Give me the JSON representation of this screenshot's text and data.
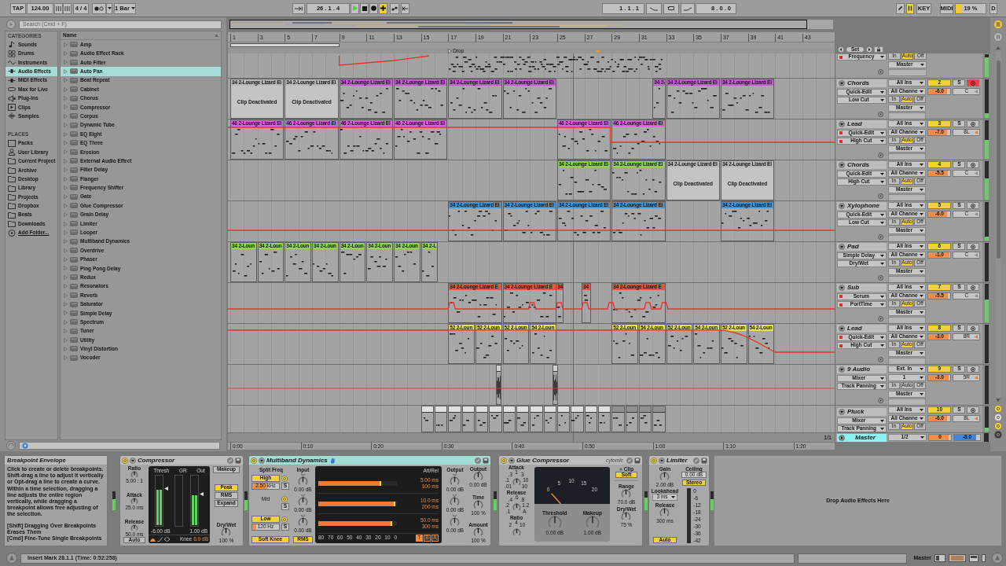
{
  "transport": {
    "tap": "TAP",
    "tempo": "124.00",
    "signature": "4 / 4",
    "quantize": "1 Bar",
    "position": "26 . 1 . 4",
    "playing": true,
    "recording": false,
    "overdub": true,
    "loop_start": "1 . 1 . 1",
    "loop_length": "8 . 0 . 0",
    "draw_mode": false,
    "computer_keyboard": true,
    "key": "KEY",
    "midi": "MIDI",
    "cpu": {
      "reading": "19 %",
      "level": 0.19
    },
    "disk": "D"
  },
  "browser": {
    "search": {
      "placeholder": "Search (Cmd + F)"
    },
    "categories_title": "CATEGORIES",
    "categories": [
      {
        "label": "Sounds",
        "kind": "sounds",
        "selected": false
      },
      {
        "label": "Drums",
        "kind": "drums",
        "selected": false
      },
      {
        "label": "Instruments",
        "kind": "instruments",
        "selected": false
      },
      {
        "label": "Audio Effects",
        "kind": "audio",
        "selected": true
      },
      {
        "label": "MIDI Effects",
        "kind": "midi",
        "selected": false
      },
      {
        "label": "Max for Live",
        "kind": "max",
        "selected": false
      },
      {
        "label": "Plug-ins",
        "kind": "plugins",
        "selected": false
      },
      {
        "label": "Clips",
        "kind": "clips",
        "selected": false
      },
      {
        "label": "Samples",
        "kind": "samples",
        "selected": false
      }
    ],
    "places_title": "PLACES",
    "places": [
      {
        "label": "Packs",
        "kind": "packs"
      },
      {
        "label": "User Library",
        "kind": "user"
      },
      {
        "label": "Current Project",
        "kind": "project"
      },
      {
        "label": "Archive",
        "kind": "folder"
      },
      {
        "label": "Desktop",
        "kind": "folder"
      },
      {
        "label": "Library",
        "kind": "folder"
      },
      {
        "label": "Projects",
        "kind": "folder"
      },
      {
        "label": "Dropbox",
        "kind": "folder"
      },
      {
        "label": "Beats",
        "kind": "folder"
      },
      {
        "label": "Downloads",
        "kind": "folder"
      },
      {
        "label": "Add Folder...",
        "kind": "add"
      }
    ],
    "column": "Name",
    "items": [
      {
        "label": "Amp",
        "selected": false
      },
      {
        "label": "Audio Effect Rack",
        "selected": false
      },
      {
        "label": "Auto Filter",
        "selected": false
      },
      {
        "label": "Auto Pan",
        "selected": true
      },
      {
        "label": "Beat Repeat",
        "selected": false
      },
      {
        "label": "Cabinet",
        "selected": false
      },
      {
        "label": "Chorus",
        "selected": false
      },
      {
        "label": "Compressor",
        "selected": false
      },
      {
        "label": "Corpus",
        "selected": false
      },
      {
        "label": "Dynamic Tube",
        "selected": false
      },
      {
        "label": "EQ Eight",
        "selected": false
      },
      {
        "label": "EQ Three",
        "selected": false
      },
      {
        "label": "Erosion",
        "selected": false
      },
      {
        "label": "External Audio Effect",
        "selected": false
      },
      {
        "label": "Filter Delay",
        "selected": false
      },
      {
        "label": "Flanger",
        "selected": false
      },
      {
        "label": "Frequency Shifter",
        "selected": false
      },
      {
        "label": "Gate",
        "selected": false
      },
      {
        "label": "Glue Compressor",
        "selected": false
      },
      {
        "label": "Grain Delay",
        "selected": false
      },
      {
        "label": "Limiter",
        "selected": false
      },
      {
        "label": "Looper",
        "selected": false
      },
      {
        "label": "Multiband Dynamics",
        "selected": false
      },
      {
        "label": "Overdrive",
        "selected": false
      },
      {
        "label": "Phaser",
        "selected": false
      },
      {
        "label": "Ping Pong Delay",
        "selected": false
      },
      {
        "label": "Redux",
        "selected": false
      },
      {
        "label": "Resonators",
        "selected": false
      },
      {
        "label": "Reverb",
        "selected": false
      },
      {
        "label": "Saturator",
        "selected": false
      },
      {
        "label": "Simple Delay",
        "selected": false
      },
      {
        "label": "Spectrum",
        "selected": false
      },
      {
        "label": "Tuner",
        "selected": false
      },
      {
        "label": "Utility",
        "selected": false
      },
      {
        "label": "Vinyl Distortion",
        "selected": false
      },
      {
        "label": "Vocoder",
        "selected": false
      }
    ]
  },
  "arrangement": {
    "bars": [
      "1",
      "3",
      "5",
      "7",
      "9",
      "11",
      "13",
      "15",
      "17",
      "19",
      "21",
      "23",
      "25",
      "27",
      "29",
      "31",
      "33",
      "35",
      "37",
      "39",
      "41",
      "43"
    ],
    "marker": "Drop",
    "set": "Set",
    "tracks": [
      {
        "parameter": {
          "label": "Frequency",
          "automated": true
        },
        "monitor": [
          {
            "label": "In",
            "selected": false
          },
          {
            "label": "Auto",
            "selected": true
          },
          {
            "label": "Off",
            "selected": false
          }
        ],
        "output": "Master",
        "meter": {
          "level": 0.85
        }
      },
      {
        "kind": "midi",
        "title": {
          "label": "Chords",
          "selected": false
        },
        "device": {
          "label": "Quick-Edit",
          "automated": false
        },
        "parameter": {
          "label": "Low Cut",
          "automated": false
        },
        "input": "All Ins",
        "channel": "All Channe",
        "monitor": [
          {
            "label": "In",
            "selected": false
          },
          {
            "label": "Auto",
            "selected": true
          },
          {
            "label": "Off",
            "selected": false
          }
        ],
        "output": "Master",
        "activator": {
          "label": "2",
          "on": true
        },
        "solo": "S",
        "armed": true,
        "volume": {
          "reading": "-6.0",
          "level": 0.86
        },
        "pan": {
          "reading": "C",
          "on": false
        },
        "meter": {
          "level": 0.12
        },
        "clips": [
          {
            "title": "34 2-Lounge Lizard El",
            "active": false,
            "note": "Clip Deactivated"
          },
          {
            "title": "34 2-Lounge Lizard El",
            "active": false,
            "note": "Clip Deactivated"
          },
          {
            "title": "34 2-Lounge Lizard El",
            "active": true,
            "color": "#c25ecf"
          },
          {
            "title": "34 2-Lounge Lizard El",
            "active": true,
            "color": "#c25ecf"
          },
          {
            "title": "34 2-Lounge Lizard El",
            "active": true,
            "color": "#c25ecf"
          },
          {
            "title": "34 2-Lounge Lizard El",
            "active": true,
            "color": "#c25ecf"
          },
          {
            "title": "34 2-",
            "active": true,
            "color": "#c25ecf"
          },
          {
            "title": "34 2-Lounge Lizard El",
            "active": true,
            "color": "#c25ecf"
          },
          {
            "title": "34 2-Lounge Lizard El",
            "active": true,
            "color": "#c25ecf"
          }
        ]
      },
      {
        "kind": "midi",
        "title": {
          "label": "Lead",
          "selected": false
        },
        "device": {
          "label": "Quick-Edit",
          "automated": true
        },
        "parameter": {
          "label": "High Cut",
          "automated": true
        },
        "input": "All Ins",
        "channel": "All Channe",
        "monitor": [
          {
            "label": "In",
            "selected": false
          },
          {
            "label": "Auto",
            "selected": true
          },
          {
            "label": "Off",
            "selected": false
          }
        ],
        "output": "Master",
        "activator": {
          "label": "3",
          "on": true
        },
        "solo": "S",
        "armed": false,
        "volume": {
          "reading": "-7.0",
          "level": 0.84
        },
        "pan": {
          "reading": "8L",
          "on": true
        },
        "meter": {
          "level": 0.5
        },
        "clips": [
          {
            "title": "46 2-Lounge Lizard El",
            "active": true,
            "color": "#e05ce2"
          },
          {
            "title": "46 2-Lounge Lizard El",
            "active": true,
            "color": "#e05ce2"
          },
          {
            "title": "46 2-Lounge Lizard El",
            "active": true,
            "color": "#e05ce2"
          },
          {
            "title": "46 2-Lounge Lizard El",
            "active": true,
            "color": "#e05ce2"
          },
          {
            "title": "46 2-Lounge Lizard El",
            "active": true,
            "color": "#e05ce2"
          },
          {
            "title": "46 2-Lounge Lizard El",
            "active": true,
            "color": "#e05ce2"
          }
        ]
      },
      {
        "kind": "midi",
        "title": {
          "label": "Chords",
          "selected": false
        },
        "device": {
          "label": "Quick-Edit",
          "automated": false
        },
        "parameter": {
          "label": "High Cut",
          "automated": false
        },
        "input": "All Ins",
        "channel": "All Channe",
        "monitor": [
          {
            "label": "In",
            "selected": false
          },
          {
            "label": "Auto",
            "selected": true
          },
          {
            "label": "Off",
            "selected": false
          }
        ],
        "output": "Master",
        "activator": {
          "label": "4",
          "on": true
        },
        "solo": "S",
        "armed": false,
        "volume": {
          "reading": "-5.5",
          "level": 0.87
        },
        "pan": {
          "reading": "C",
          "on": false
        },
        "meter": {
          "level": 0.55
        },
        "clips": [
          {
            "title": "34 2-Lounge Lizard El",
            "active": true,
            "color": "#8dd642"
          },
          {
            "title": "34 2-Lounge Lizard El",
            "active": true,
            "color": "#8dd642"
          },
          {
            "title": "34 2-Lounge Lizard El",
            "active": false,
            "note": "Clip Deactivated"
          },
          {
            "title": "34 2-Lounge Lizard El",
            "active": false,
            "note": "Clip Deactivated"
          }
        ]
      },
      {
        "kind": "midi",
        "title": {
          "label": "Xylophone",
          "selected": false
        },
        "device": {
          "label": "Quick-Edit",
          "automated": false
        },
        "parameter": {
          "label": "Low Cut",
          "automated": false
        },
        "input": "All Ins",
        "channel": "All Channe",
        "monitor": [
          {
            "label": "In",
            "selected": false
          },
          {
            "label": "Auto",
            "selected": true
          },
          {
            "label": "Off",
            "selected": false
          }
        ],
        "output": "Master",
        "activator": {
          "label": "5",
          "on": true
        },
        "solo": "S",
        "armed": false,
        "volume": {
          "reading": "-6.0",
          "level": 0.86
        },
        "pan": {
          "reading": "C",
          "on": false
        },
        "meter": {
          "level": 0.1
        },
        "clips": [
          {
            "title": "34 2-Lounge Lizard El",
            "active": true,
            "color": "#3f96d8"
          },
          {
            "title": "34 2-Lounge Lizard El",
            "active": true,
            "color": "#3f96d8"
          },
          {
            "title": "34 2-Lounge Lizard El",
            "active": true,
            "color": "#3f96d8"
          },
          {
            "title": "34 2-Lounge Lizard El",
            "active": true,
            "color": "#3f96d8"
          },
          {
            "title": "34 2-Lounge Lizard El",
            "active": true,
            "color": "#3f96d8"
          }
        ]
      },
      {
        "kind": "midi",
        "title": {
          "label": "Pad",
          "selected": false
        },
        "device": {
          "label": "Simple Delay",
          "automated": false
        },
        "parameter": {
          "label": "Dry/Wet",
          "automated": false
        },
        "input": "All Ins",
        "channel": "All Channe",
        "monitor": [
          {
            "label": "In",
            "selected": false
          },
          {
            "label": "Auto",
            "selected": true
          },
          {
            "label": "Off",
            "selected": false
          }
        ],
        "output": "Master",
        "activator": {
          "label": "6",
          "on": true
        },
        "solo": "S",
        "armed": false,
        "volume": {
          "reading": "-1.0",
          "level": 0.96
        },
        "pan": {
          "reading": "C",
          "on": false
        },
        "clips": [
          {
            "title": "34 2-Loun",
            "active": true,
            "color": "#92d64c"
          },
          {
            "title": "34 2-Loun",
            "active": true,
            "color": "#92d64c"
          },
          {
            "title": "34 2-Loun",
            "active": true,
            "color": "#92d64c"
          },
          {
            "title": "34 2-Loun",
            "active": true,
            "color": "#92d64c"
          },
          {
            "title": "34 2-Loun",
            "active": true,
            "color": "#92d64c"
          },
          {
            "title": "34 2-Loun",
            "active": true,
            "color": "#92d64c"
          },
          {
            "title": "34 2-Loun",
            "active": true,
            "color": "#92d64c"
          },
          {
            "title": "34 2-L",
            "active": true,
            "color": "#92d64c"
          }
        ]
      },
      {
        "kind": "midi",
        "title": {
          "label": "Sub",
          "selected": false
        },
        "device": {
          "label": "Serum",
          "automated": true
        },
        "parameter": {
          "label": "PortTime",
          "automated": true
        },
        "input": "All Ins",
        "channel": "All Channe",
        "monitor": [
          {
            "label": "In",
            "selected": false
          },
          {
            "label": "Auto",
            "selected": true
          },
          {
            "label": "Off",
            "selected": false
          }
        ],
        "output": "Master",
        "activator": {
          "label": "7",
          "on": true
        },
        "solo": "S",
        "armed": false,
        "volume": {
          "reading": "-5.5",
          "level": 0.87
        },
        "pan": {
          "reading": "C",
          "on": false
        },
        "meter": {
          "level": 0.6
        },
        "clips": [
          {
            "title": "34 2-Lounge Lizard E",
            "active": true,
            "color": "#e3583c"
          },
          {
            "title": "34 2-Lounge Lizard E",
            "active": true,
            "color": "#e3583c"
          },
          {
            "title": "34",
            "active": true,
            "color": "#e3583c"
          },
          {
            "title": "34",
            "active": true,
            "color": "#e3583c"
          },
          {
            "title": "34 2-Lounge Lizard E",
            "active": true,
            "color": "#e3583c"
          }
        ]
      },
      {
        "kind": "midi",
        "title": {
          "label": "Lead",
          "selected": false
        },
        "device": {
          "label": "Quick-Edit",
          "automated": true
        },
        "parameter": {
          "label": "High Cut",
          "automated": true
        },
        "input": "All Ins",
        "channel": "All Channe",
        "monitor": [
          {
            "label": "In",
            "selected": false
          },
          {
            "label": "Auto",
            "selected": true
          },
          {
            "label": "Off",
            "selected": false
          }
        ],
        "output": "Master",
        "activator": {
          "label": "8",
          "on": true
        },
        "solo": "S",
        "armed": false,
        "volume": {
          "reading": "-3.0",
          "level": 0.92
        },
        "pan": {
          "reading": "8R",
          "on": true
        },
        "clips": [
          {
            "title": "52 2-Loun",
            "active": true,
            "color": "#e7e24f"
          },
          {
            "title": "52 2-Loun",
            "active": true,
            "color": "#e7e24f"
          },
          {
            "title": "52 2-Loun",
            "active": true,
            "color": "#e7e24f"
          },
          {
            "title": "54 2-Loun",
            "active": true,
            "color": "#e7e24f"
          },
          {
            "title": "52 2-Loun",
            "active": true,
            "color": "#e7e24f"
          },
          {
            "title": "54 2-Loun",
            "active": true,
            "color": "#e7e24f"
          },
          {
            "title": "52 2-Loun",
            "active": true,
            "color": "#e7e24f"
          },
          {
            "title": "54 2-Loun",
            "active": true,
            "color": "#e7e24f"
          },
          {
            "title": "52 2-Loun",
            "active": true,
            "color": "#e7e24f"
          },
          {
            "title": "54 2-Loun",
            "active": true,
            "color": "#e7e24f"
          }
        ]
      },
      {
        "kind": "audio",
        "title": {
          "label": "9 Audio",
          "selected": false
        },
        "device": {
          "label": "Mixer",
          "automated": false
        },
        "parameter": {
          "label": "Track Panning",
          "automated": false
        },
        "input": "Ext. In",
        "channel": "1",
        "monitor": [
          {
            "label": "In",
            "selected": false
          },
          {
            "label": "Auto",
            "selected": false
          },
          {
            "label": "Off",
            "selected": false
          }
        ],
        "output": "Master",
        "activator": {
          "label": "9",
          "on": true
        },
        "solo": "S",
        "armed": false,
        "volume": {
          "reading": "-3.0",
          "level": 0.92
        },
        "pan": {
          "reading": "5R",
          "on": true
        },
        "clips": [
          {
            "active": true,
            "color": "#d0d0d0"
          },
          {
            "active": true,
            "color": "#d0d0d0"
          }
        ]
      },
      {
        "kind": "midi",
        "title": {
          "label": "Pluck",
          "selected": false
        },
        "device": {
          "label": "Mixer",
          "automated": false
        },
        "parameter": {
          "label": "Track Panning",
          "automated": false
        },
        "input": "All Ins",
        "channel": "All Channe",
        "monitor": [
          {
            "label": "In",
            "selected": false
          },
          {
            "label": "Auto",
            "selected": true
          },
          {
            "label": "Off",
            "selected": false
          }
        ],
        "activator": {
          "label": "10",
          "on": true
        },
        "solo": "S",
        "armed": false,
        "volume": {
          "reading": "-6.0",
          "level": 0.86
        },
        "pan": {
          "reading": "8L",
          "on": true
        },
        "meter": {
          "level": 0.15
        },
        "clips": [
          {
            "active": true,
            "color": "#e0e0e0"
          },
          {
            "active": true,
            "color": "#e0e0e0"
          },
          {
            "active": true,
            "color": "#e0e0e0"
          },
          {
            "active": true,
            "color": "#e0e0e0"
          },
          {
            "active": true,
            "color": "#e0e0e0"
          },
          {
            "active": true,
            "color": "#e0e0e0"
          },
          {
            "active": true,
            "color": "#e0e0e0"
          },
          {
            "active": true,
            "color": "#e0e0e0"
          },
          {
            "active": true,
            "color": "#e0e0e0"
          },
          {
            "active": true,
            "color": "#e0e0e0"
          },
          {
            "active": true,
            "color": "#e0e0e0"
          },
          {
            "active": true,
            "color": "#e0e0e0"
          },
          {
            "active": true,
            "color": "#e0e0e0"
          },
          {
            "active": true,
            "color": "#e0e0e0"
          },
          {
            "active": true,
            "color": "#8f8f8f"
          },
          {
            "active": true,
            "color": "#8f8f8f"
          },
          {
            "active": true,
            "color": "#8f8f8f"
          },
          {
            "active": true,
            "color": "#8f8f8f"
          }
        ]
      }
    ],
    "master": {
      "title": {
        "label": "Master",
        "selected": true
      },
      "output": "1/2",
      "volume": {
        "reading": "0",
        "level": 0.9
      },
      "cue": {
        "reading": "-8.0",
        "level": 0.85
      }
    },
    "grid": "1/1",
    "times": [
      "0:00",
      "0:10",
      "0:20",
      "0:30",
      "0:40",
      "0:50",
      "1:00",
      "1:10",
      "1:20"
    ]
  },
  "devices": {
    "info": {
      "title": "Breakpoint Envelope",
      "text": "Click to create or delete breakpoints. Shift-drag a line to adjust it vertically or Opt-drag a line to create a curve. Within a time selection, dragging a line adjusts the entire region vertically, while dragging a breakpoint allows free adjusting of the selection.",
      "shortcuts": [
        "[Shift] Dragging Over Breakpoints Erases Them",
        "[Cmd] Fine-Tune Single Breakpoints"
      ]
    },
    "chain_meters": [
      {
        "level": 0.6
      },
      {
        "level": 0.55
      },
      {
        "level": 0.6
      },
      {
        "level": 0.65
      },
      {
        "level": 0.6
      }
    ],
    "compressor": {
      "title": "Compressor",
      "on": true,
      "selected": false,
      "knobs": [
        {
          "label": "Ratio",
          "value": "5.00 : 1"
        },
        {
          "label": "Attack",
          "value": "25.0 ms"
        },
        {
          "label": "Release",
          "value": "50.0 ms"
        }
      ],
      "auto": {
        "label": "Auto",
        "on": false
      },
      "meters": [
        {
          "label": "Thresh",
          "value": "-6.00 dB",
          "level": 0.72
        },
        {
          "label": "GR"
        },
        {
          "label": "Out",
          "value": "1.00 dB",
          "level": 0.62
        }
      ],
      "knee": {
        "label": "Knee",
        "value": "6.0 dB"
      },
      "makeup": {
        "label": "Makeup",
        "on": false
      },
      "modes": [
        {
          "label": "Peak",
          "selected": true
        },
        {
          "label": "RMS",
          "selected": false
        },
        {
          "label": "Expand",
          "selected": false
        }
      ],
      "drywet": {
        "label": "Dry/Wet",
        "value": "100 %"
      }
    },
    "multiband": {
      "title": "Multiband Dynamics",
      "on": true,
      "selected": true,
      "split_label": "Split Freq",
      "input_label": "Input",
      "output_label": "Output",
      "attrel_label": "Att/Rel",
      "bands": [
        {
          "name": "High",
          "kind": "toggle",
          "on": true,
          "split": {
            "reading": "2.50 kHz",
            "level": 0.55
          },
          "solo": "S",
          "input": "0.00 dB",
          "output": "0.00 dB",
          "bar": {
            "level": 0.8
          },
          "attack": "5.00 ms",
          "release": "100 ms"
        },
        {
          "name": "Mid",
          "kind": "label",
          "on": true,
          "solo": "S",
          "input": "0.00 dB",
          "output": "0.00 dB",
          "bar": {
            "level": 0.98
          },
          "attack": "10.0 ms",
          "release": "200 ms"
        },
        {
          "name": "Low",
          "kind": "toggle",
          "on": true,
          "split": {
            "reading": "120 Hz",
            "level": 0.15
          },
          "solo": "S",
          "input": "0.00 dB",
          "output": "0.00 dB",
          "bar": {
            "level": 0.94
          },
          "attack": "50.0 ms",
          "release": "300 ms"
        }
      ],
      "scale": [
        "80",
        "70",
        "60",
        "50",
        "40",
        "30",
        "20",
        "10",
        "0"
      ],
      "soft_knee": {
        "label": "Soft Knee",
        "on": true
      },
      "rms": {
        "label": "RMS",
        "on": true
      },
      "views": [
        {
          "label": "T",
          "selected": true
        },
        {
          "label": "B",
          "selected": false
        },
        {
          "label": "A",
          "selected": false
        }
      ],
      "master_out": {
        "label": "Output",
        "value": "0.00 dB"
      },
      "time": {
        "label": "Time",
        "value": "100 %"
      },
      "amount": {
        "label": "Amount",
        "value": "100 %"
      }
    },
    "glue": {
      "title": "Glue Compressor",
      "brand": "cytomic",
      "on": true,
      "selected": false,
      "dials": [
        {
          "label": "Attack",
          "ticks": [
            [
              "1"
            ],
            [
              ".3",
              "3"
            ],
            [
              ".1",
              "10"
            ],
            [
              ".01",
              "30"
            ]
          ]
        },
        {
          "label": "Release",
          "ticks": [
            [
              ".6"
            ],
            [
              ".4",
              ".8"
            ],
            [
              ".2",
              "1.2"
            ],
            [
              ".1",
              "A"
            ]
          ]
        },
        {
          "label": "Ratio",
          "ticks": [
            [
              "4"
            ],
            [
              "2",
              "10"
            ]
          ]
        }
      ],
      "vu": {
        "ticks": [
          "0",
          "5",
          "10",
          "15",
          "20"
        ]
      },
      "threshold": {
        "label": "Threshold",
        "value": "0.00 dB"
      },
      "makeup": {
        "label": "Makeup",
        "value": "1.00 dB"
      },
      "clip": {
        "label": "Clip",
        "mode": {
          "label": "Soft",
          "on": true
        }
      },
      "range": {
        "label": "Range",
        "value": "70.0 dB"
      },
      "drywet": {
        "label": "Dry/Wet",
        "value": "75 %"
      }
    },
    "limiter": {
      "title": "Limiter",
      "on": true,
      "selected": false,
      "gain": {
        "label": "Gain",
        "value": "2.00 dB"
      },
      "ceiling": {
        "label": "Ceiling",
        "value": "0.00 dB"
      },
      "stereo": {
        "label": "Stereo",
        "on": true
      },
      "lookahead": {
        "label": "Lookahead",
        "value": "3 ms"
      },
      "release": {
        "label": "Release",
        "value": "300 ms"
      },
      "auto": {
        "label": "Auto",
        "on": true
      },
      "scale": [
        "0",
        "-6",
        "-12",
        "-18",
        "-24",
        "-30",
        "-36",
        "-42"
      ]
    },
    "drop_hint": "Drop Audio Effects Here"
  },
  "status": {
    "message": "Insert Mark 28.1.1 (Time: 0:52:258)",
    "track": "Master"
  }
}
